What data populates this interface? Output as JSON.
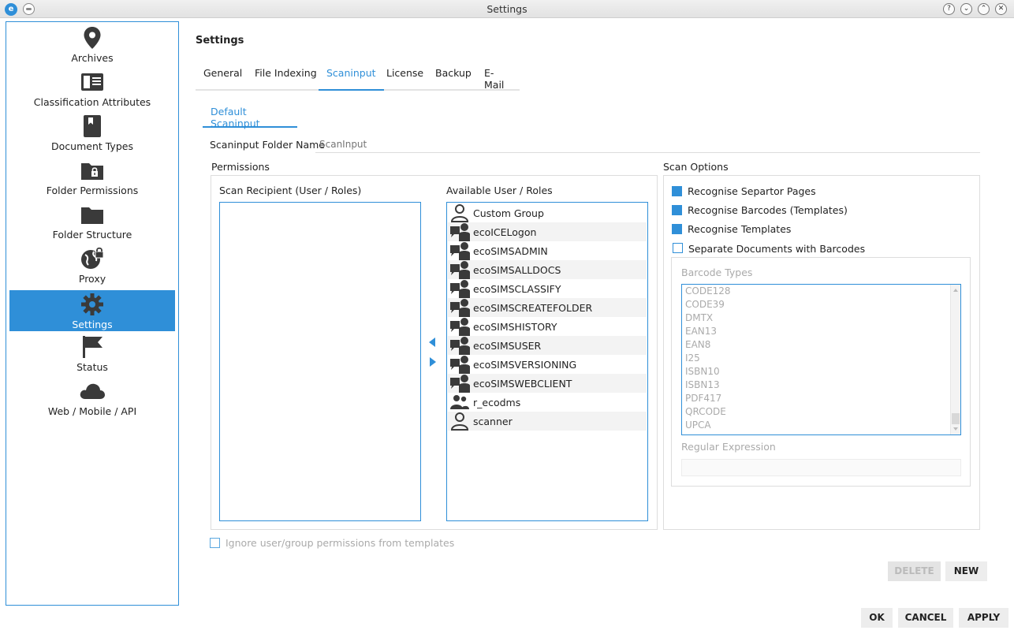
{
  "window": {
    "title": "Settings"
  },
  "sidebar": {
    "items": [
      {
        "label": "Archives",
        "icon": "map-pin-icon"
      },
      {
        "label": "Classification Attributes",
        "icon": "classification-card-icon"
      },
      {
        "label": "Document Types",
        "icon": "bookmark-icon"
      },
      {
        "label": "Folder Permissions",
        "icon": "locked-folder-icon"
      },
      {
        "label": "Folder Structure",
        "icon": "folder-icon"
      },
      {
        "label": "Proxy",
        "icon": "globe-lock-icon"
      },
      {
        "label": "Settings",
        "icon": "gear-icon",
        "active": true
      },
      {
        "label": "Status",
        "icon": "flag-icon"
      },
      {
        "label": "Web / Mobile / API",
        "icon": "cloud-icon"
      }
    ]
  },
  "main": {
    "title": "Settings",
    "tabs": [
      {
        "label": "General"
      },
      {
        "label": "File Indexing"
      },
      {
        "label": "Scaninput",
        "active": true
      },
      {
        "label": "License"
      },
      {
        "label": "Backup"
      },
      {
        "label": "E-Mail"
      }
    ],
    "subtab": "Default Scaninput",
    "folder_name_label": "Scaninput Folder Name",
    "folder_name_placeholder": "ScanInput",
    "permissions": {
      "group_label": "Permissions",
      "recipient_label": "Scan Recipient (User / Roles)",
      "available_label": "Available User / Roles",
      "recipients": [],
      "available": [
        {
          "name": "Custom Group",
          "icon": "user-icon"
        },
        {
          "name": "ecoICELogon",
          "icon": "role-icon"
        },
        {
          "name": "ecoSIMSADMIN",
          "icon": "role-icon"
        },
        {
          "name": "ecoSIMSALLDOCS",
          "icon": "role-icon"
        },
        {
          "name": "ecoSIMSCLASSIFY",
          "icon": "role-icon"
        },
        {
          "name": "ecoSIMSCREATEFOLDER",
          "icon": "role-icon"
        },
        {
          "name": "ecoSIMSHISTORY",
          "icon": "role-icon"
        },
        {
          "name": "ecoSIMSUSER",
          "icon": "role-icon"
        },
        {
          "name": "ecoSIMSVERSIONING",
          "icon": "role-icon"
        },
        {
          "name": "ecoSIMSWEBCLIENT",
          "icon": "role-icon"
        },
        {
          "name": "r_ecodms",
          "icon": "group-icon"
        },
        {
          "name": "scanner",
          "icon": "user-icon"
        }
      ],
      "ignore_template_label": "Ignore user/group permissions from templates"
    },
    "scan_options": {
      "group_label": "Scan Options",
      "options": [
        {
          "label": "Recognise Separtor Pages",
          "checked": true
        },
        {
          "label": "Recognise Barcodes (Templates)",
          "checked": true
        },
        {
          "label": "Recognise Templates",
          "checked": true
        },
        {
          "label": "Separate Documents with Barcodes",
          "checked": false
        }
      ],
      "barcode_types_label": "Barcode Types",
      "barcode_types": [
        "CODE128",
        "CODE39",
        "DMTX",
        "EAN13",
        "EAN8",
        "I25",
        "ISBN10",
        "ISBN13",
        "PDF417",
        "QRCODE",
        "UPCA"
      ],
      "regex_label": "Regular Expression"
    }
  },
  "buttons": {
    "delete": "DELETE",
    "new": "NEW",
    "ok": "OK",
    "cancel": "CANCEL",
    "apply": "APPLY"
  },
  "colors": {
    "accent": "#2f8fd8",
    "icon": "#3a3a3a"
  }
}
